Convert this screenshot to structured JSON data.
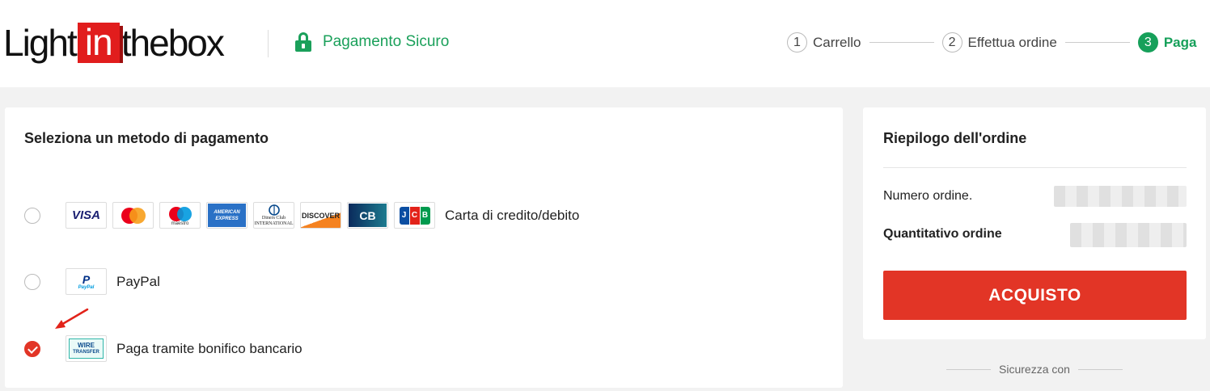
{
  "header": {
    "logo": {
      "part1": "Light",
      "part2": "in",
      "part3": "thebox"
    },
    "secure_label": "Pagamento Sicuro",
    "steps": [
      {
        "num": "1",
        "label": "Carrello"
      },
      {
        "num": "2",
        "label": "Effettua ordine"
      },
      {
        "num": "3",
        "label": "Paga"
      }
    ],
    "active_step": "3"
  },
  "payment": {
    "title": "Seleziona un metodo di pagamento",
    "methods": [
      {
        "label": "Carta di credito/debito",
        "selected": false,
        "cards": [
          "VISA",
          "Mastercard",
          "maestro",
          "AMERICAN EXPRESS",
          "Diners Club INTERNATIONAL",
          "DISCOVER",
          "CB",
          "JCB"
        ]
      },
      {
        "label": "PayPal",
        "selected": false,
        "icon_text": "PayPal"
      },
      {
        "label": "Paga tramite bonifico bancario",
        "selected": true,
        "icon_text": [
          "WIRE",
          "TRANSFER"
        ]
      }
    ]
  },
  "summary": {
    "title": "Riepilogo dell'ordine",
    "order_number_label": "Numero ordine.",
    "order_amount_label": "Quantitativo ordine",
    "buy_label": "ACQUISTO"
  },
  "security_label": "Sicurezza con",
  "colors": {
    "accent_red": "#e23526",
    "secure_green": "#1aa05a"
  }
}
